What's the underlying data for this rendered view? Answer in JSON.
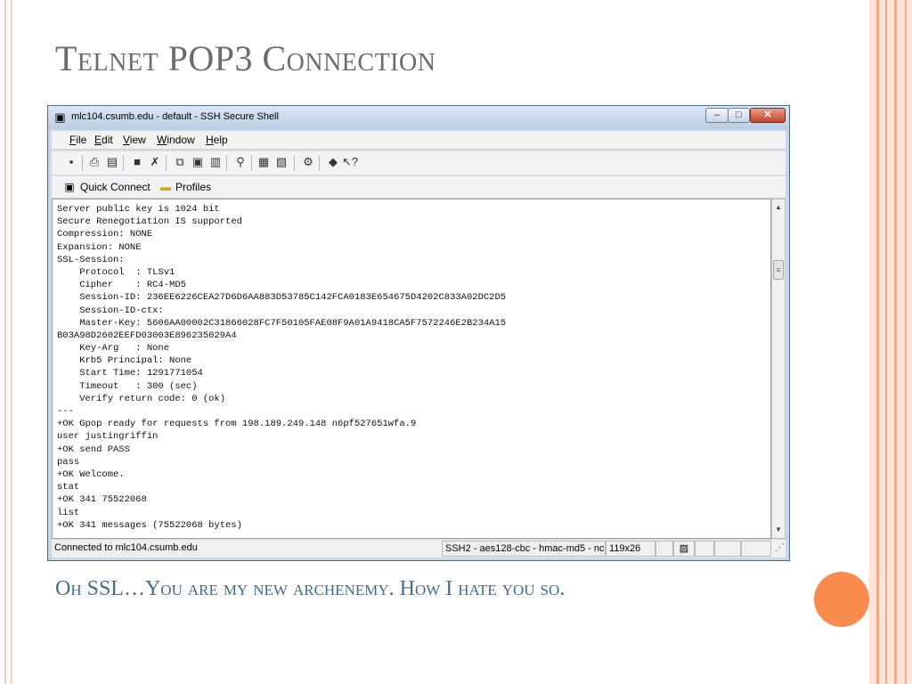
{
  "slide": {
    "title": "Telnet POP3 Connection",
    "caption": "Oh SSL…You are my new archenemy. How I hate you so."
  },
  "window": {
    "title": "mlc104.csumb.edu - default - SSH Secure Shell",
    "menu": [
      "File",
      "Edit",
      "View",
      "Window",
      "Help"
    ],
    "quick_connect": "Quick Connect",
    "profiles": "Profiles",
    "controls": {
      "minimize": "–",
      "maximize": "□",
      "close": "✕"
    }
  },
  "terminal": {
    "lines": [
      "Server public key is 1024 bit",
      "Secure Renegotiation IS supported",
      "Compression: NONE",
      "Expansion: NONE",
      "SSL-Session:",
      "    Protocol  : TLSv1",
      "    Cipher    : RC4-MD5",
      "    Session-ID: 236EE6226CEA27D6D6AA883D53785C142FCA0183E654675D4202C833A02DC2D5",
      "    Session-ID-ctx:",
      "    Master-Key: 5606AA00002C31866028FC7F50105FAE08F9A01A9418CA5F7572246E2B234A15",
      "B03A98D2602EEFD03003E896235029A4",
      "    Key-Arg   : None",
      "    Krb5 Principal: None",
      "    Start Time: 1291771054",
      "    Timeout   : 300 (sec)",
      "    Verify return code: 0 (ok)",
      "---",
      "+OK Gpop ready for requests from 198.189.249.148 n6pf527651wfa.9",
      "user justingriffin",
      "+OK send PASS",
      "pass",
      "+OK Welcome.",
      "stat",
      "+OK 341 75522068",
      "list",
      "+OK 341 messages (75522068 bytes)"
    ]
  },
  "status": {
    "connection": "Connected to mlc104.csumb.edu",
    "cipher": "SSH2 - aes128-cbc - hmac-md5 - nc",
    "size": "119x26"
  },
  "colors": {
    "title_text": "#6b6b6b",
    "caption_text": "#3f6d8a",
    "accent_orange": "#f98b4f",
    "side_band": "#fbe3d8"
  }
}
